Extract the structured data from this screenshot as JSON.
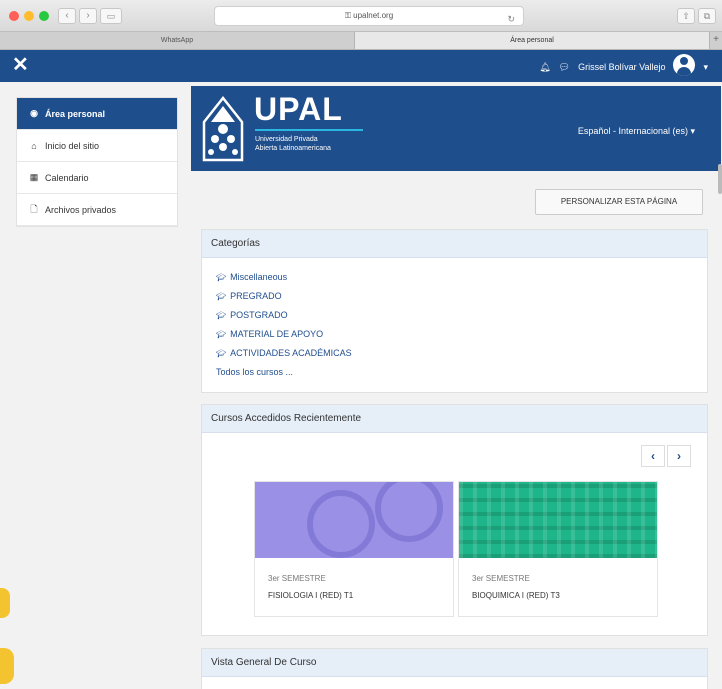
{
  "browser": {
    "url": "upalnet.org",
    "tabs": [
      "WhatsApp",
      "Área personal"
    ]
  },
  "topnav": {
    "user_name": "Grissel Bolívar Vallejo"
  },
  "drawer": {
    "items": [
      {
        "label": "Área personal",
        "icon": "dashboard-icon",
        "active": true
      },
      {
        "label": "Inicio del sitio",
        "icon": "home-icon",
        "active": false
      },
      {
        "label": "Calendario",
        "icon": "calendar-icon",
        "active": false
      },
      {
        "label": "Archivos privados",
        "icon": "file-icon",
        "active": false
      }
    ]
  },
  "header": {
    "logo_text": "UPAL",
    "logo_sub1": "Universidad Privada",
    "logo_sub2": "Abierta Latinoamericana",
    "language": "Español - Internacional (es) ▾"
  },
  "customize_button": "PERSONALIZAR ESTA PÁGINA",
  "categories": {
    "title": "Categorías",
    "items": [
      "Miscellaneous",
      "PREGRADO",
      "POSTGRADO",
      "MATERIAL DE APOYO",
      "ACTIVIDADES ACADÉMICAS"
    ],
    "all_courses": "Todos los cursos ..."
  },
  "recent": {
    "title": "Cursos Accedidos Recientemente",
    "courses": [
      {
        "category": "3er SEMESTRE",
        "name": "FISIOLOGIA I (RED) T1"
      },
      {
        "category": "3er SEMESTRE",
        "name": "BIOQUIMICA I (RED) T3"
      }
    ]
  },
  "overview": {
    "title": "Vista General De Curso"
  },
  "colors": {
    "brand": "#1f4e8c",
    "card_header": "#e6eef8"
  }
}
